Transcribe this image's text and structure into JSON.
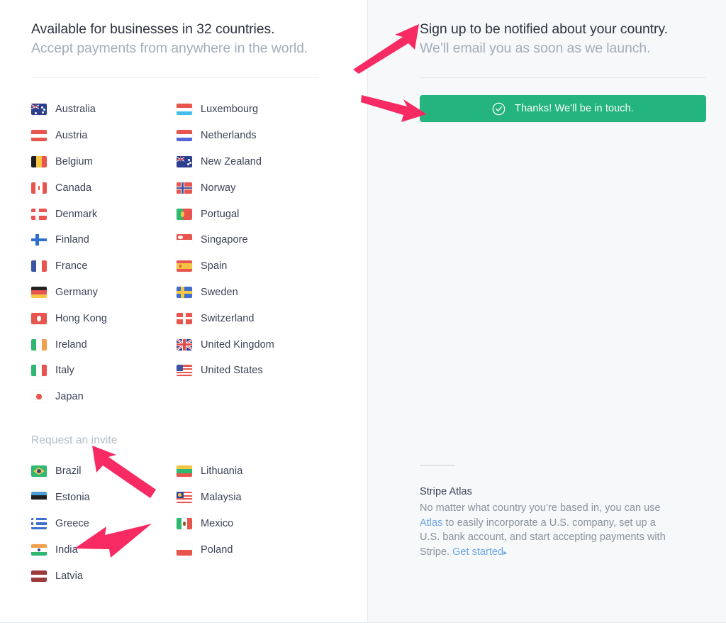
{
  "left": {
    "heading": "Available for businesses in 32 countries.",
    "subheading": "Accept payments from anywhere in the world.",
    "invite_heading": "Request an invite",
    "available_countries": [
      {
        "name": "Australia",
        "flag": "flag-australia"
      },
      {
        "name": "Austria",
        "flag": "flag-austria"
      },
      {
        "name": "Belgium",
        "flag": "flag-belgium"
      },
      {
        "name": "Canada",
        "flag": "flag-canada"
      },
      {
        "name": "Denmark",
        "flag": "flag-denmark"
      },
      {
        "name": "Finland",
        "flag": "flag-finland"
      },
      {
        "name": "France",
        "flag": "flag-france"
      },
      {
        "name": "Germany",
        "flag": "flag-germany"
      },
      {
        "name": "Hong Kong",
        "flag": "flag-hong-kong"
      },
      {
        "name": "Ireland",
        "flag": "flag-ireland"
      },
      {
        "name": "Italy",
        "flag": "flag-italy"
      },
      {
        "name": "Japan",
        "flag": "flag-japan"
      },
      {
        "name": "Luxembourg",
        "flag": "flag-luxembourg"
      },
      {
        "name": "Netherlands",
        "flag": "flag-netherlands"
      },
      {
        "name": "New Zealand",
        "flag": "flag-new-zealand"
      },
      {
        "name": "Norway",
        "flag": "flag-norway"
      },
      {
        "name": "Portugal",
        "flag": "flag-portugal"
      },
      {
        "name": "Singapore",
        "flag": "flag-singapore"
      },
      {
        "name": "Spain",
        "flag": "flag-spain"
      },
      {
        "name": "Sweden",
        "flag": "flag-sweden"
      },
      {
        "name": "Switzerland",
        "flag": "flag-switzerland"
      },
      {
        "name": "United Kingdom",
        "flag": "flag-united-kingdom"
      },
      {
        "name": "United States",
        "flag": "flag-united-states"
      }
    ],
    "invite_countries": [
      {
        "name": "Brazil",
        "flag": "flag-brazil"
      },
      {
        "name": "Estonia",
        "flag": "flag-estonia"
      },
      {
        "name": "Greece",
        "flag": "flag-greece"
      },
      {
        "name": "India",
        "flag": "flag-india"
      },
      {
        "name": "Latvia",
        "flag": "flag-latvia"
      },
      {
        "name": "Lithuania",
        "flag": "flag-lithuania"
      },
      {
        "name": "Malaysia",
        "flag": "flag-malaysia"
      },
      {
        "name": "Mexico",
        "flag": "flag-mexico"
      },
      {
        "name": "Poland",
        "flag": "flag-poland"
      }
    ]
  },
  "right": {
    "heading": "Sign up to be notified about your country.",
    "subheading": "We’ll email you as soon as we launch.",
    "success_message": "Thanks! We'll be in touch.",
    "success_icon": "check-circle-icon",
    "footer": {
      "title": "Stripe Atlas",
      "body_part1": "No matter what country you’re based in, you can use ",
      "link_atlas": "Atlas",
      "body_part2": " to easily incorporate a U.S. company, set up a U.S. bank account, and start accepting payments with Stripe. ",
      "link_get_started": "Get started",
      "caret": "▸"
    }
  },
  "annotations": {
    "arrow_color": "#f72a63",
    "arrows": [
      {
        "name": "arrow-to-signup-heading"
      },
      {
        "name": "arrow-to-success-banner"
      },
      {
        "name": "arrow-to-request-invite"
      },
      {
        "name": "arrow-to-india"
      }
    ]
  },
  "colors": {
    "accent_green": "#24b47e",
    "link_blue": "#6ba5e7",
    "annotation_pink": "#f72a63",
    "panel_bg": "#f6f8f9"
  }
}
